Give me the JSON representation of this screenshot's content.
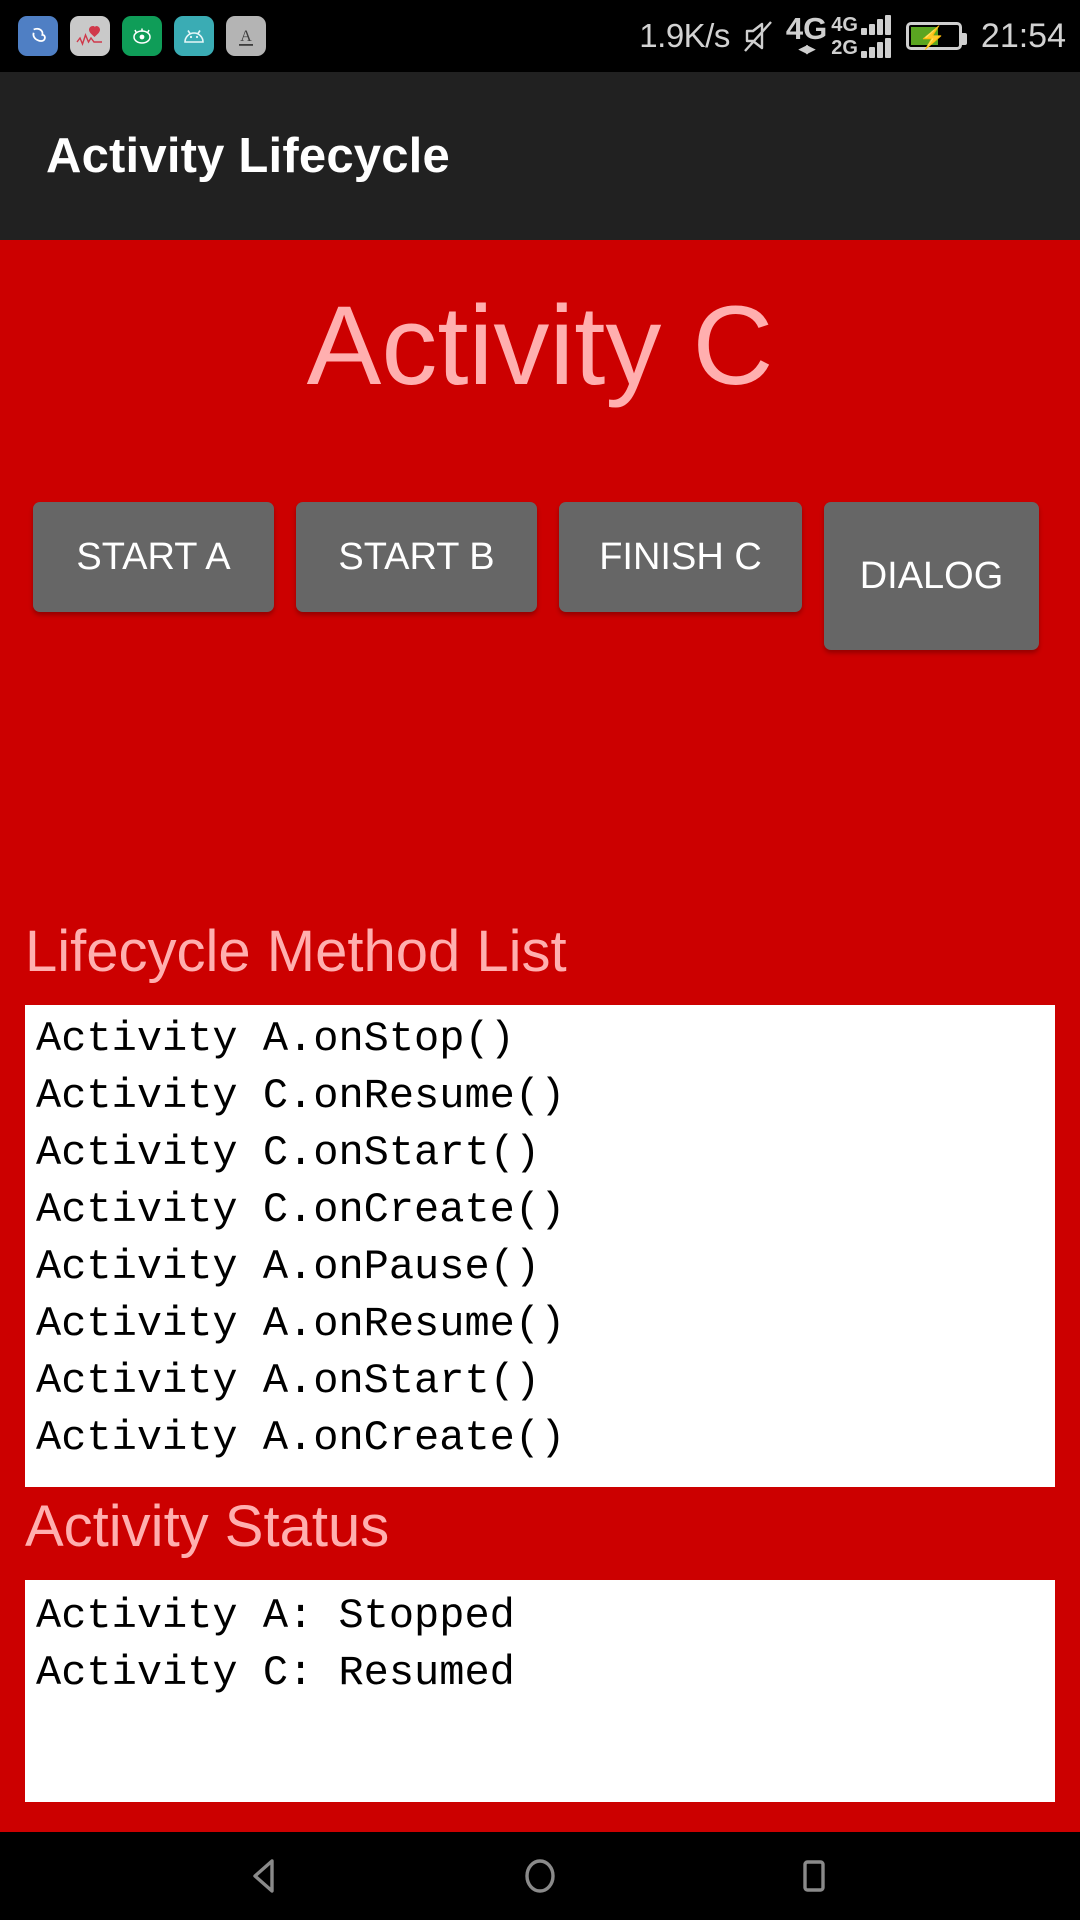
{
  "status_bar": {
    "notification_icons": [
      {
        "name": "cloud-sync-icon",
        "color": "#4f7fc4"
      },
      {
        "name": "heart-rate-icon",
        "color": "#c9c9c9"
      },
      {
        "name": "eye-care-icon",
        "color": "#0f9d58"
      },
      {
        "name": "android-robot-icon",
        "color": "#3aacb4"
      },
      {
        "name": "letter-a-icon",
        "color": "#b4b4b4"
      }
    ],
    "network_speed": "1.9K/s",
    "mute_icon": "mute-bell-icon",
    "data_type": "4G",
    "sim1_label": "4G",
    "sim2_label": "2G",
    "battery_charging": true,
    "clock": "21:54"
  },
  "app_bar": {
    "title": "Activity Lifecycle"
  },
  "screen": {
    "title": "Activity C",
    "background_color": "#CC0000",
    "accent_text_color": "#FFAFAF"
  },
  "buttons": [
    {
      "label": "START A",
      "name": "start-a-button"
    },
    {
      "label": "START B",
      "name": "start-b-button"
    },
    {
      "label": "FINISH C",
      "name": "finish-c-button"
    },
    {
      "label": "DIALOG",
      "name": "dialog-button"
    }
  ],
  "method_list": {
    "label": "Lifecycle Method List",
    "lines": [
      "Activity A.onStop()",
      "Activity C.onResume()",
      "Activity C.onStart()",
      "Activity C.onCreate()",
      "Activity A.onPause()",
      "Activity A.onResume()",
      "Activity A.onStart()",
      "Activity A.onCreate()"
    ]
  },
  "activity_status": {
    "label": "Activity Status",
    "lines": [
      "Activity A: Stopped",
      "Activity C: Resumed"
    ]
  },
  "nav_bar": {
    "back": "back-nav-icon",
    "home": "home-nav-icon",
    "recents": "recents-nav-icon"
  }
}
